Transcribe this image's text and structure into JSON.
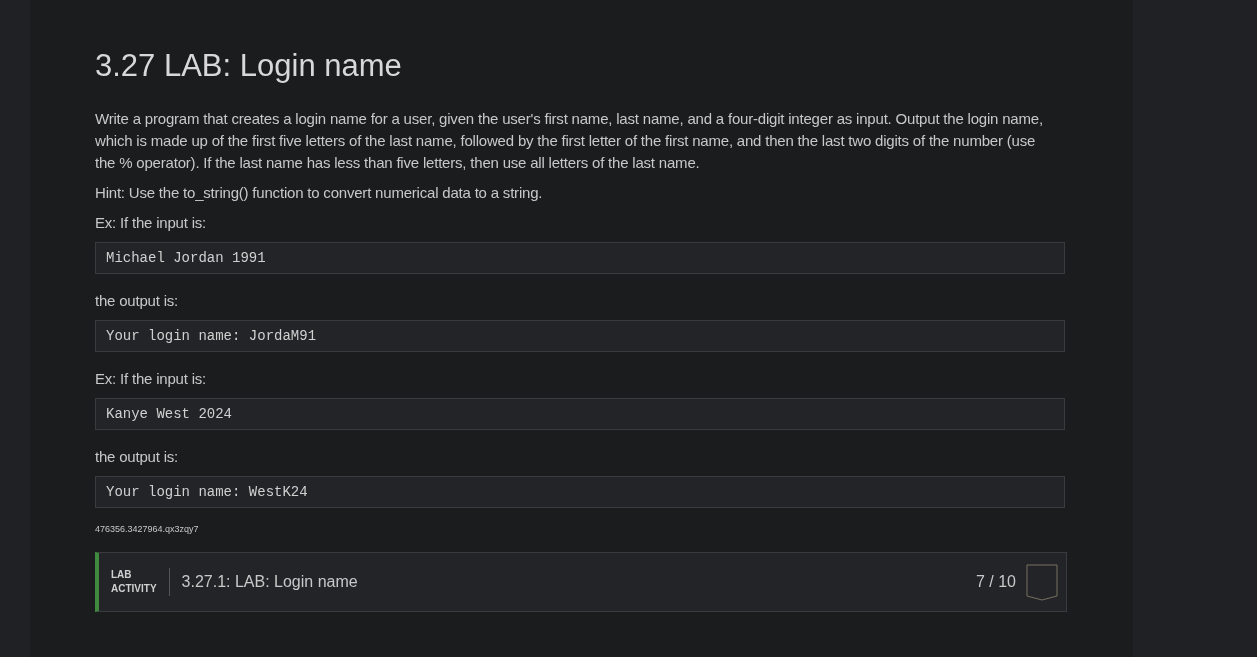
{
  "title": "3.27 LAB: Login name",
  "content": [
    {
      "kind": "text",
      "text": "Write a program that creates a login name for a user, given the user's first name, last name, and a four-digit integer as input. Output the login name, which is made up of the first five letters of the last name, followed by the first letter of the first name, and then the last two digits of the number (use the % operator). If the last name has less than five letters, then use all letters of the last name."
    },
    {
      "kind": "text",
      "text": "Hint: Use the to_string() function to convert numerical data to a string."
    },
    {
      "kind": "text",
      "text": "Ex: If the input is:"
    },
    {
      "kind": "code",
      "text": "Michael Jordan 1991"
    },
    {
      "kind": "text",
      "text": "the output is:"
    },
    {
      "kind": "code",
      "text": "Your login name: JordaM91"
    },
    {
      "kind": "text",
      "text": "Ex: If the input is:"
    },
    {
      "kind": "code",
      "text": "Kanye West 2024"
    },
    {
      "kind": "text",
      "text": "the output is:"
    },
    {
      "kind": "code",
      "text": "Your login name: WestK24"
    }
  ],
  "id_code": "476356.3427964.qx3zqy7",
  "activity": {
    "type_line_1": "LAB",
    "type_line_2": "ACTIVITY",
    "title": "3.27.1: LAB: Login name",
    "score": "7 / 10"
  }
}
